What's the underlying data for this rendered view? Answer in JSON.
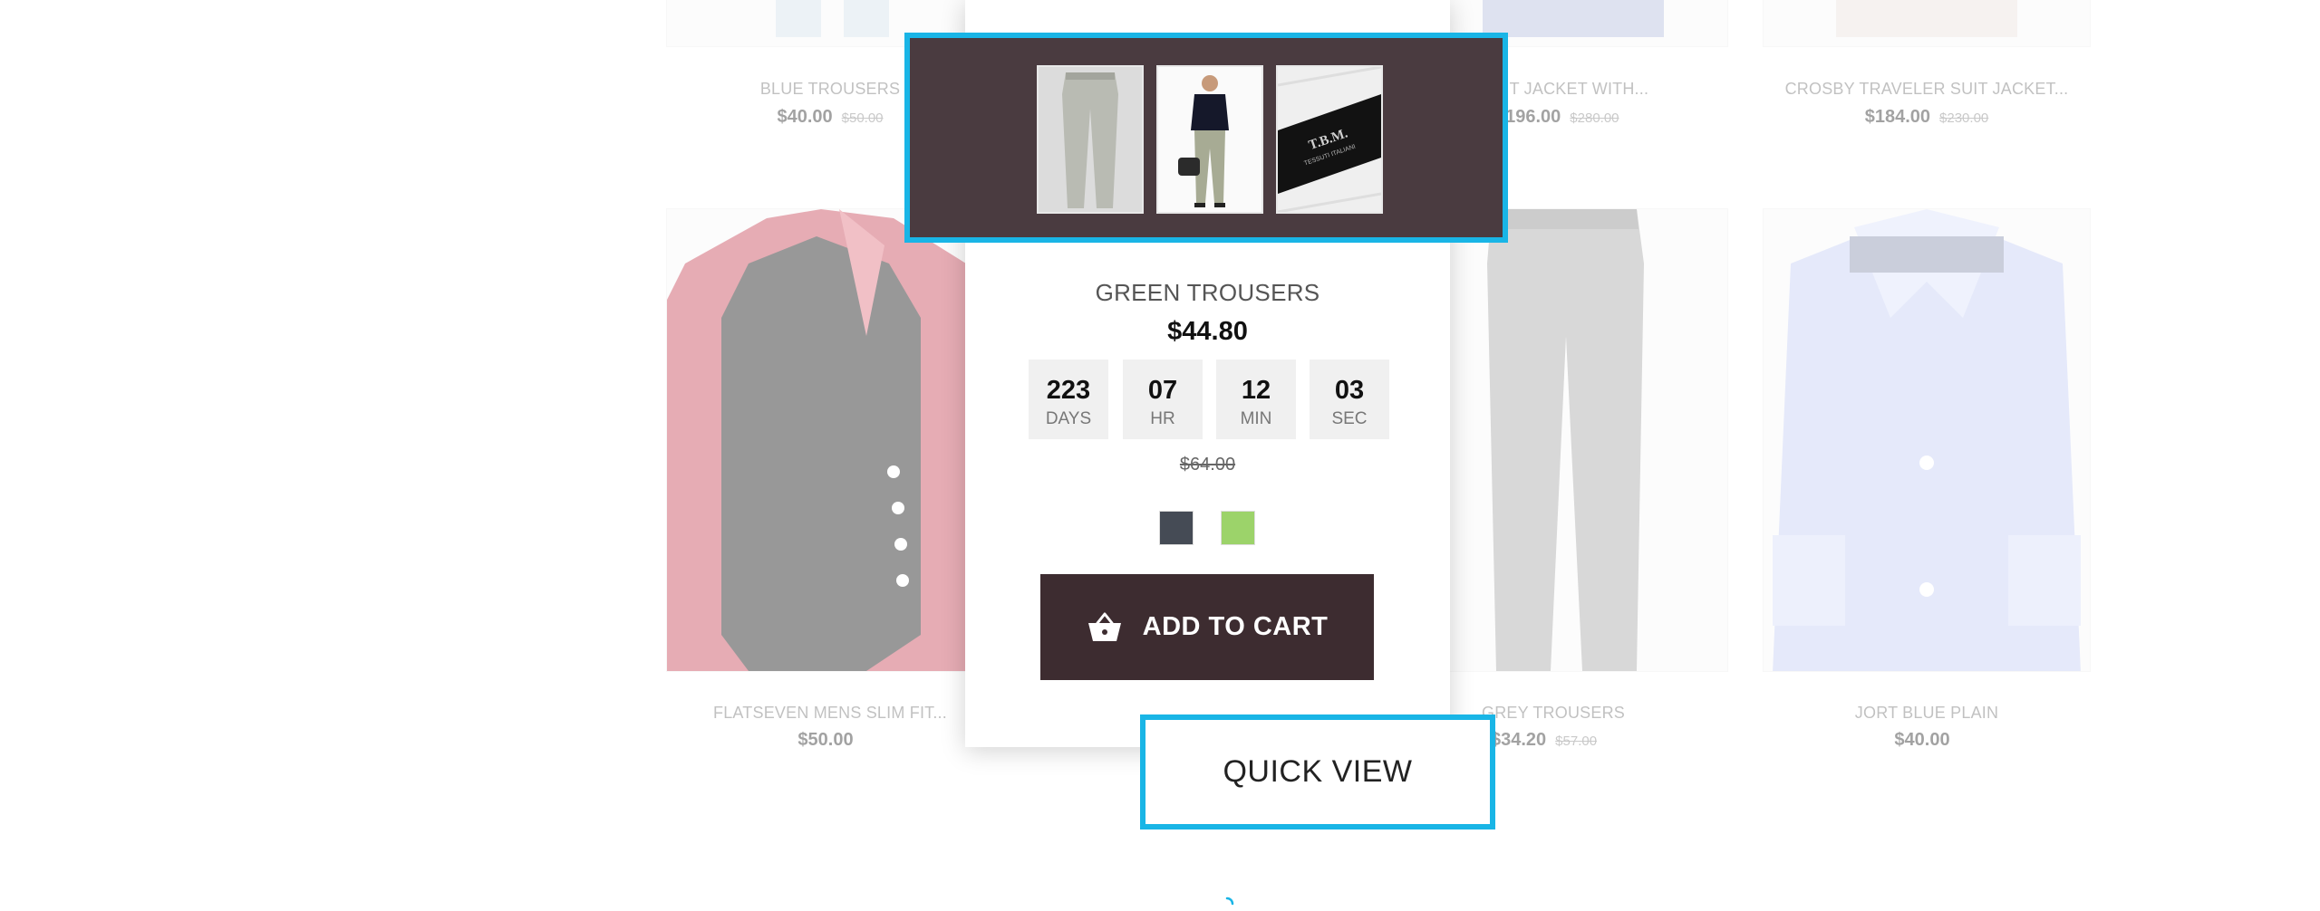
{
  "grid": {
    "cards": [
      {
        "title": "BLUE TROUSERS",
        "price": "$40.00",
        "old_price": "$50.00"
      },
      {
        "title": "SUIT JACKET WITH...",
        "price": "$196.00",
        "old_price": "$280.00"
      },
      {
        "title": "CROSBY TRAVELER SUIT JACKET...",
        "price": "$184.00",
        "old_price": "$230.00"
      },
      {
        "title": "FLATSEVEN MENS SLIM FIT...",
        "price": "$50.00",
        "old_price": ""
      },
      {
        "title": "GREY TROUSERS",
        "price": "$34.20",
        "old_price": "$57.00"
      },
      {
        "title": "JORT BLUE PLAIN",
        "price": "$40.00",
        "old_price": ""
      }
    ]
  },
  "quickview": {
    "thumbnails": [
      "trousers-front",
      "model-walking",
      "fabric-label"
    ],
    "label_brand": "T.B.M.",
    "label_sub": "TESSUTI ITALIANI",
    "title": "GREEN TROUSERS",
    "price": "$44.80",
    "countdown": [
      {
        "num": "223",
        "label": "DAYS"
      },
      {
        "num": "07",
        "label": "HR"
      },
      {
        "num": "12",
        "label": "MIN"
      },
      {
        "num": "03",
        "label": "SEC"
      }
    ],
    "old_price": "$64.00",
    "swatches": [
      "#454b55",
      "#9cd36a"
    ],
    "add_to_cart": "ADD TO CART",
    "quick_view": "QUICK VIEW"
  },
  "colors": {
    "highlight": "#19b5e6",
    "gallery_bg": "#4a3b40",
    "cart_bg": "#3d2c30"
  }
}
